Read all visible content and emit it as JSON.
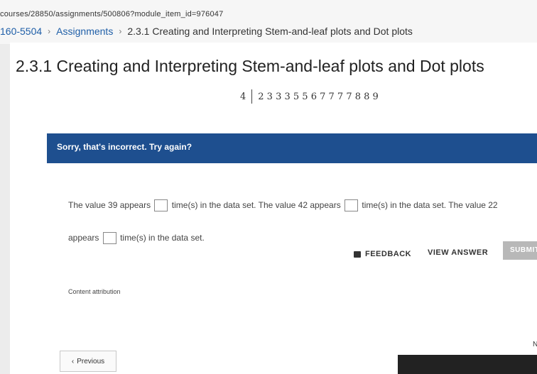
{
  "browser": {
    "url": "courses/28850/assignments/500806?module_item_id=976047"
  },
  "breadcrumb": {
    "course": "160-5504",
    "assignments": "Assignments",
    "current": "2.3.1 Creating and Interpreting Stem-and-leaf plots and Dot plots",
    "separator": "›"
  },
  "page": {
    "title": "2.3.1 Creating and Interpreting Stem-and-leaf plots and Dot plots"
  },
  "stem_leaf": {
    "stem": "4",
    "leaves": "2 3 3 3 5 5 6 7 7 7 7 8 8 9"
  },
  "banner": {
    "message": "Sorry, that's incorrect. Try again?"
  },
  "question": {
    "part1": "The value 39 appears",
    "part2": "time(s) in the data set. The value 42 appears",
    "part3": "time(s) in the data set. The value 22",
    "part4": "appears",
    "part5": "time(s) in the data set."
  },
  "actions": {
    "feedback": "FEEDBACK",
    "view_answer": "VIEW ANSWER",
    "submit": "SUBMIT"
  },
  "footer": {
    "attribution": "Content attribution",
    "previous": "Previous",
    "previous_icon": "‹",
    "next_partial": "N"
  }
}
